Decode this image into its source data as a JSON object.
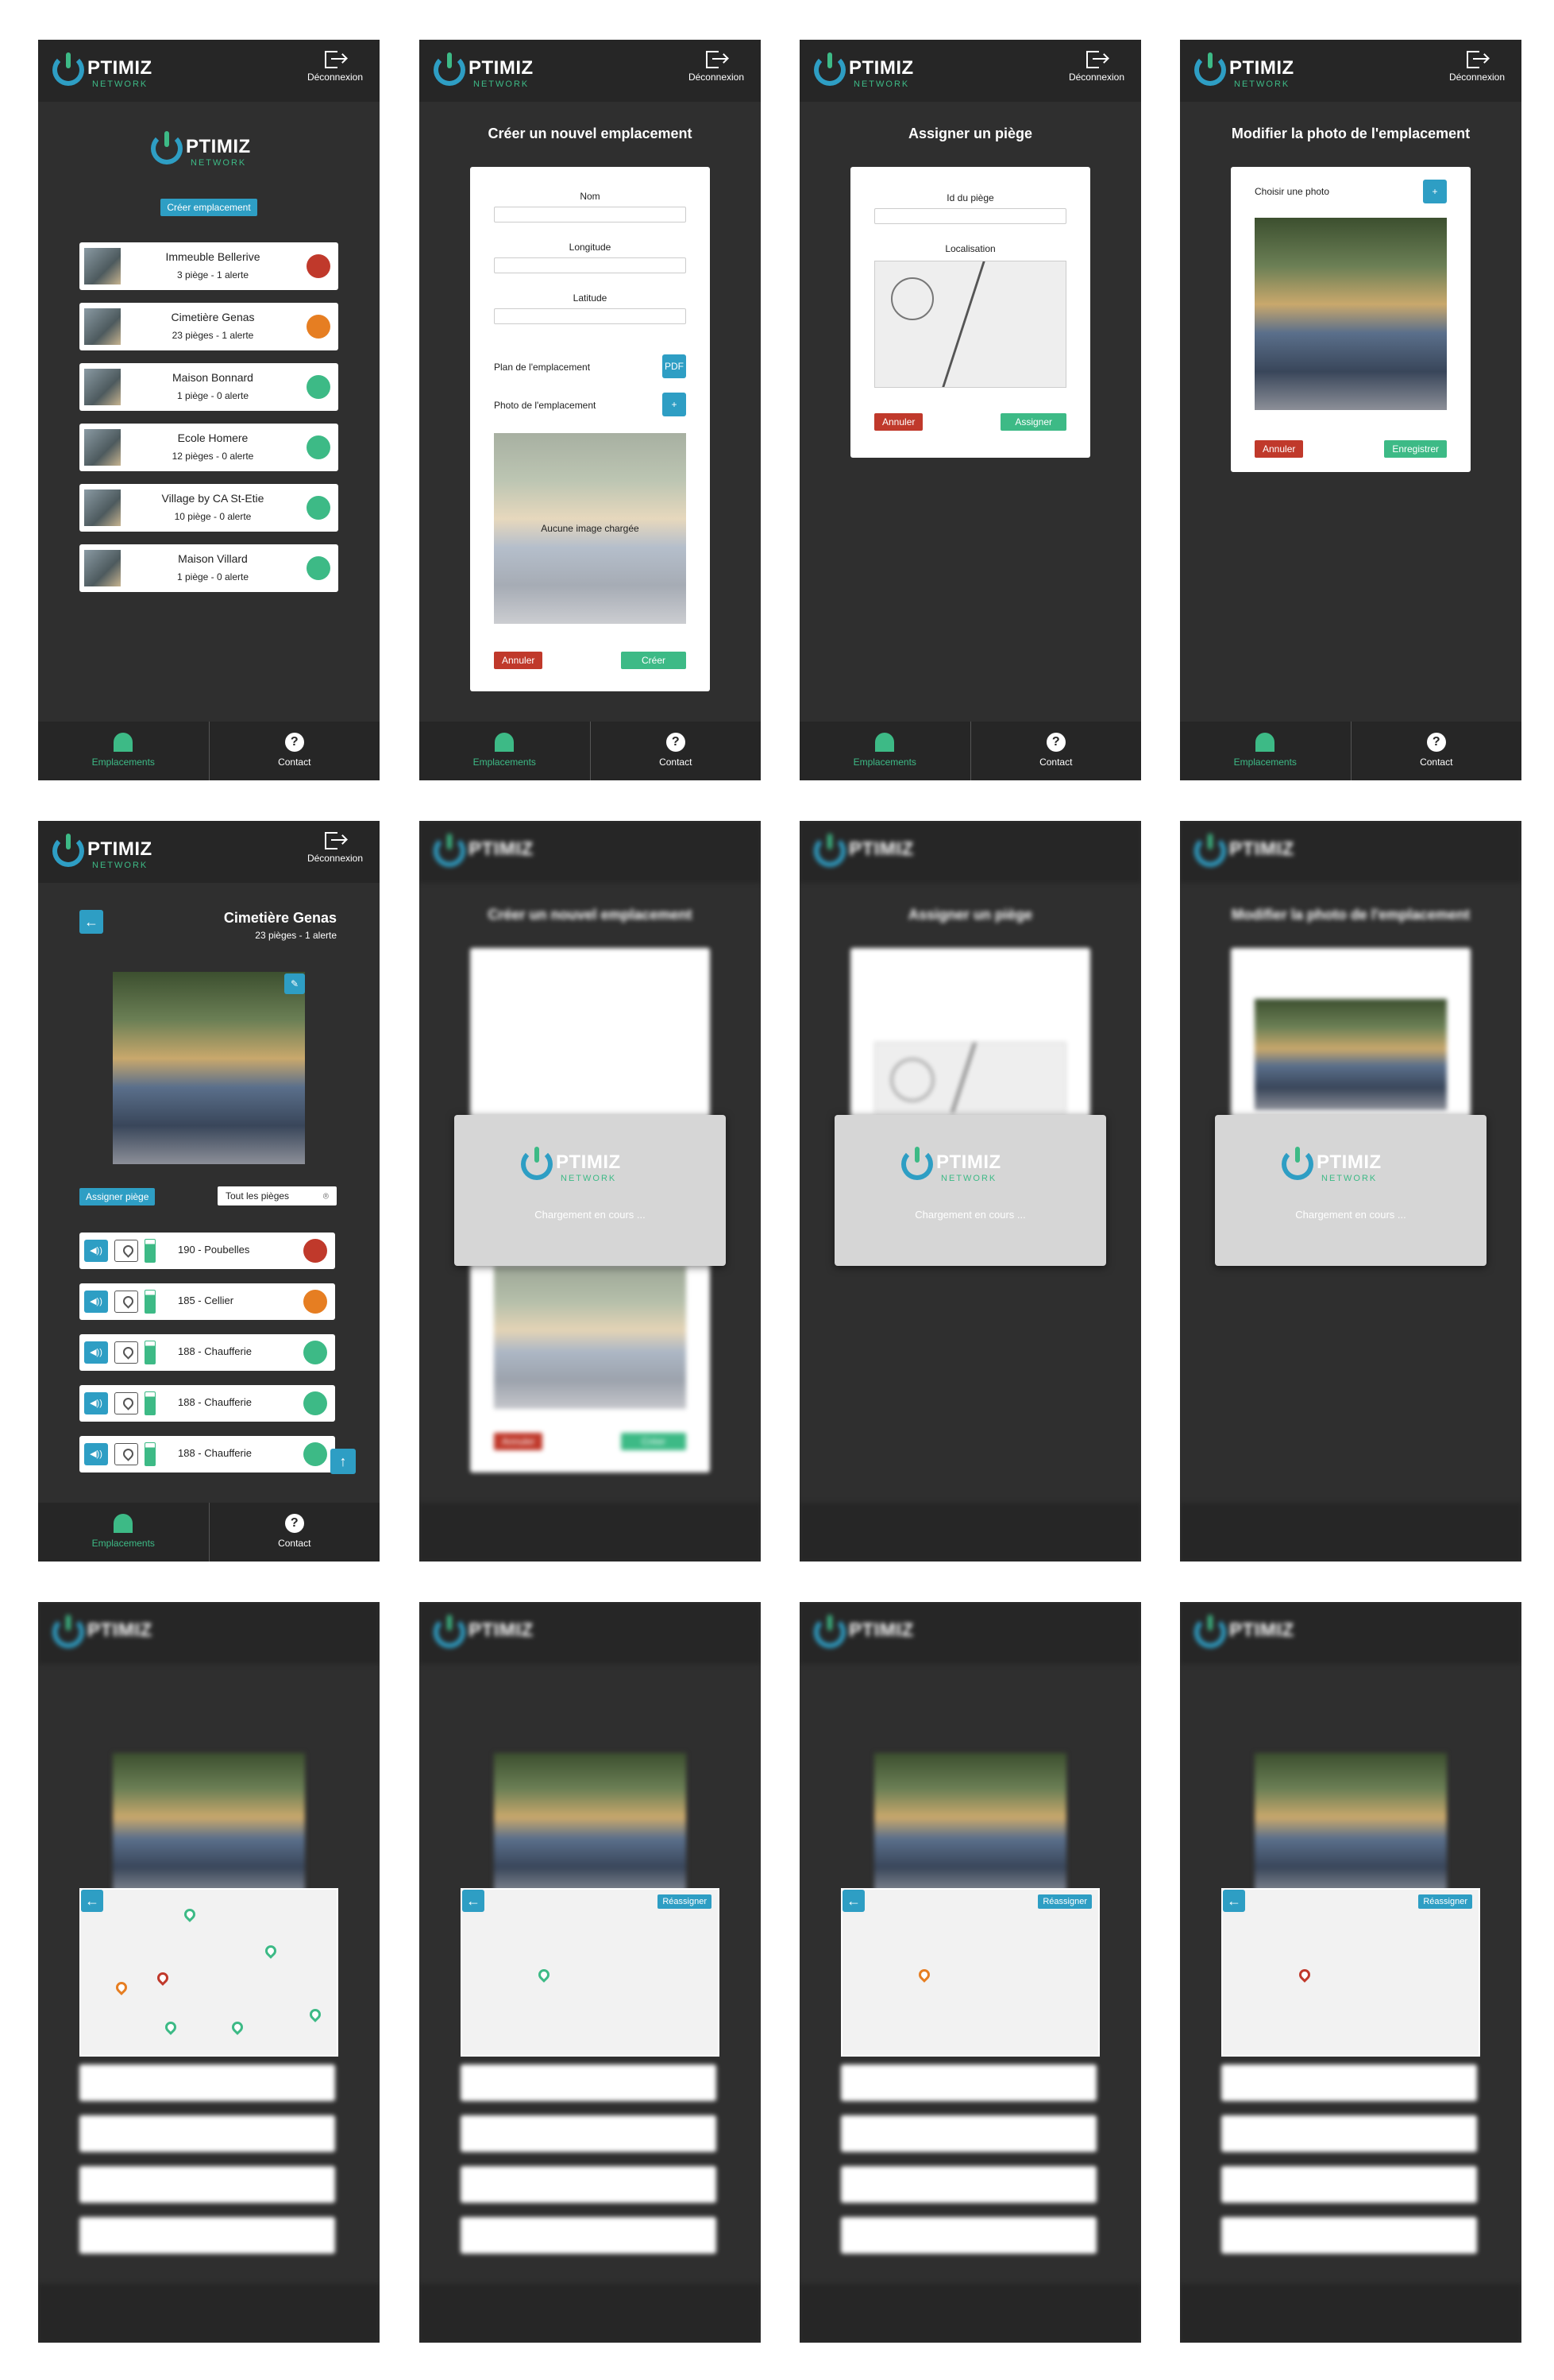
{
  "app": {
    "brand": "PTIMIZ",
    "brand_sub": "NETWORK",
    "logout_label": "Déconnexion",
    "tabs": [
      {
        "label": "Emplacements",
        "icon": "home-icon"
      },
      {
        "label": "Contact",
        "icon": "help-icon"
      }
    ]
  },
  "locations": {
    "create_button": "Créer emplacement",
    "items": [
      {
        "name": "Immeuble Bellerive",
        "info": "3 piège - 1 alerte",
        "status": "red"
      },
      {
        "name": "Cimetière Genas",
        "info": "23 pièges - 1 alerte",
        "status": "orange"
      },
      {
        "name": "Maison Bonnard",
        "info": "1 piège - 0 alerte",
        "status": "green"
      },
      {
        "name": "Ecole Homere",
        "info": "12 pièges - 0 alerte",
        "status": "green"
      },
      {
        "name": "Village by CA St-Etie",
        "info": "10 piège - 0 alerte",
        "status": "green"
      },
      {
        "name": "Maison Villard",
        "info": "1 piège - 0 alerte",
        "status": "green"
      }
    ]
  },
  "create_location": {
    "title": "Créer un nouvel emplacement",
    "name_label": "Nom",
    "longitude_label": "Longitude",
    "latitude_label": "Latitude",
    "plan_label": "Plan de l'emplacement",
    "photo_label": "Photo de l'emplacement",
    "no_image": "Aucune image chargée",
    "cancel": "Annuler",
    "create": "Créer"
  },
  "assign_trap": {
    "title": "Assigner un piège",
    "trap_id_label": "Id du piège",
    "location_label": "Localisation",
    "cancel": "Annuler",
    "assign": "Assigner"
  },
  "edit_photo": {
    "title": "Modifier la photo de l'emplacement",
    "choose_label": "Choisir une photo",
    "cancel": "Annuler",
    "save": "Enregistrer"
  },
  "location_detail": {
    "name": "Cimetière Genas",
    "info": "23 pièges - 1 alerte",
    "assign_button": "Assigner piège",
    "filter_value": "Tout les pièges",
    "traps": [
      {
        "label": "190 - Poubelles",
        "status": "red"
      },
      {
        "label": "185 - Cellier",
        "status": "orange"
      },
      {
        "label": "188 - Chaufferie",
        "status": "green"
      },
      {
        "label": "188 - Chaufferie",
        "status": "green"
      },
      {
        "label": "188 - Chaufferie",
        "status": "green"
      }
    ],
    "reassign": "Réassigner"
  },
  "loading": {
    "text": "Chargement en cours ..."
  }
}
